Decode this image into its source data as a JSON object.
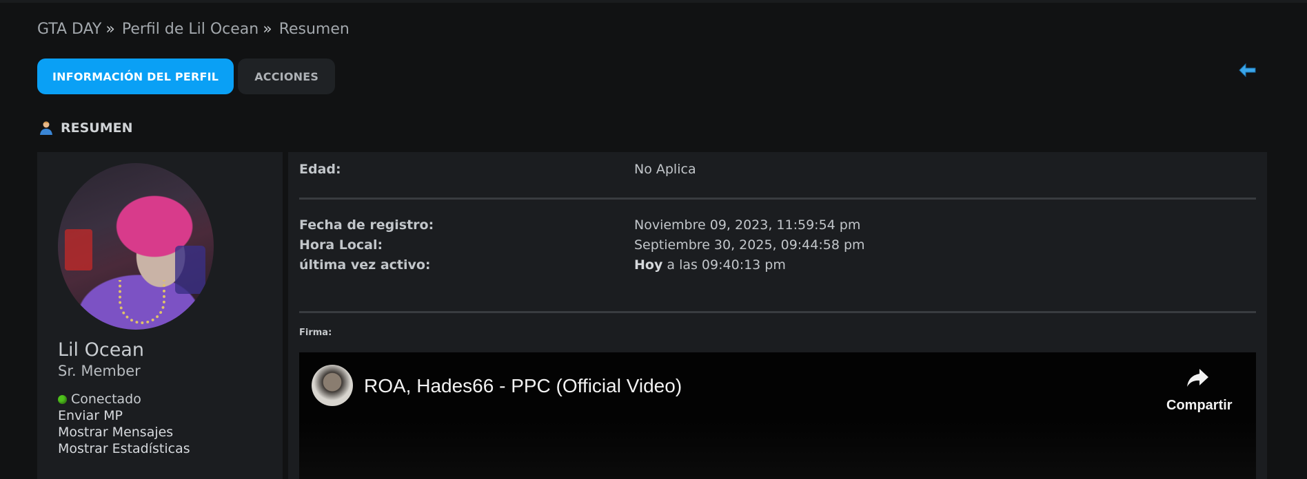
{
  "breadcrumb": [
    {
      "label": "GTA DAY"
    },
    {
      "label": "Perfil de Lil Ocean"
    },
    {
      "label": "Resumen"
    }
  ],
  "breadcrumb_separator": "»",
  "tabs": [
    {
      "label": "INFORMACIÓN DEL PERFIL",
      "active": true
    },
    {
      "label": "ACCIONES",
      "active": false
    }
  ],
  "section": {
    "title": "RESUMEN",
    "icon": "user-icon"
  },
  "profile": {
    "name": "Lil Ocean",
    "rank": "Sr. Member",
    "status": "Conectado",
    "status_color": "#4fc21c",
    "links": [
      "Enviar MP",
      "Mostrar Mensajes",
      "Mostrar Estadísticas"
    ]
  },
  "details": {
    "age_label": "Edad:",
    "age_value": "No Aplica",
    "registered_label": "Fecha de registro:",
    "registered_value": "Noviembre 09, 2023, 11:59:54 pm",
    "localtime_label": "Hora Local:",
    "localtime_value": "Septiembre 30, 2025, 09:44:58 pm",
    "lastactive_label": "última vez activo:",
    "lastactive_bold": "Hoy",
    "lastactive_value": "a las 09:40:13 pm"
  },
  "signature": {
    "label": "Firma:",
    "video_title": "ROA, Hades66 - PPC (Official Video)",
    "share_label": "Compartir"
  },
  "colors": {
    "accent": "#0aa0f5",
    "background": "#111213",
    "panel": "#1b1d20"
  }
}
